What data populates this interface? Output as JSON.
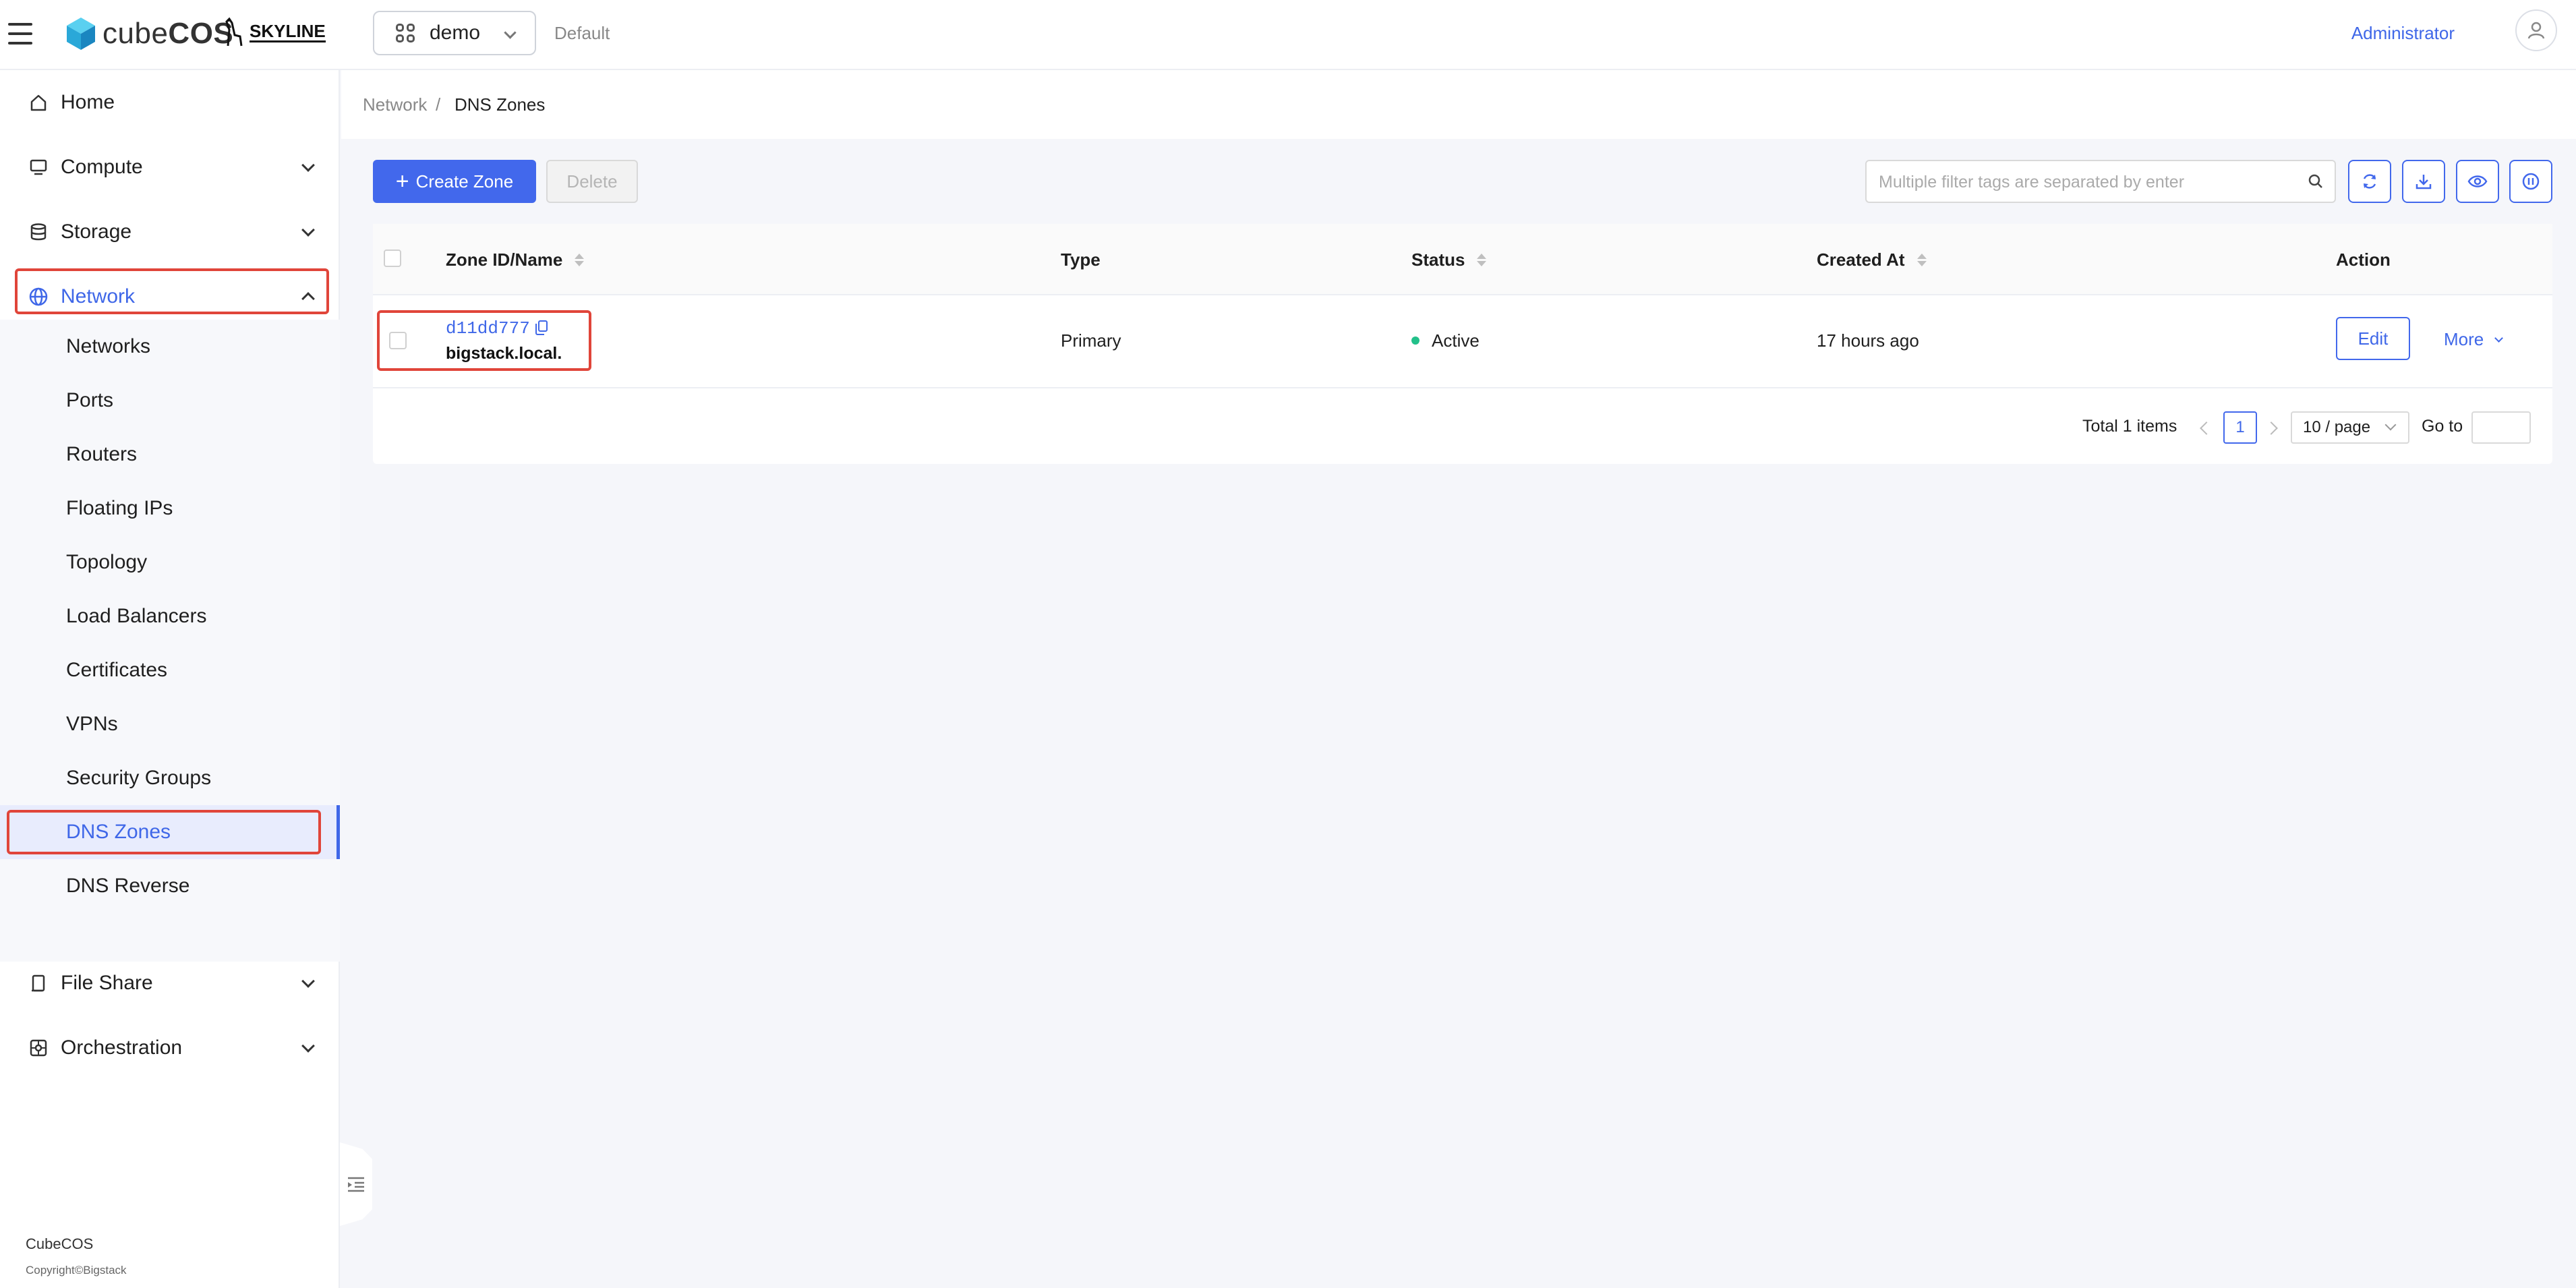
{
  "header": {
    "brand_text_light": "cube",
    "brand_text_bold": "COS",
    "partner_logo": "SKYLINE",
    "project": "demo",
    "domain": "Default",
    "user": "Administrator"
  },
  "sidebar": {
    "groups": [
      {
        "label": "Home",
        "icon": "home-icon",
        "expandable": false
      },
      {
        "label": "Compute",
        "icon": "monitor-icon",
        "expandable": true
      },
      {
        "label": "Storage",
        "icon": "database-icon",
        "expandable": true
      },
      {
        "label": "Network",
        "icon": "globe-icon",
        "expandable": true,
        "expanded": true,
        "active": true
      },
      {
        "label": "File Share",
        "icon": "file-share-icon",
        "expandable": true
      },
      {
        "label": "Orchestration",
        "icon": "orchestration-icon",
        "expandable": true
      }
    ],
    "network_items": [
      {
        "label": "Networks"
      },
      {
        "label": "Ports"
      },
      {
        "label": "Routers"
      },
      {
        "label": "Floating IPs"
      },
      {
        "label": "Topology"
      },
      {
        "label": "Load Balancers"
      },
      {
        "label": "Certificates"
      },
      {
        "label": "VPNs"
      },
      {
        "label": "Security Groups"
      },
      {
        "label": "DNS Zones",
        "selected": true
      },
      {
        "label": "DNS Reverse"
      }
    ],
    "footer_brand": "CubeCOS",
    "footer_copyright": "Copyright©Bigstack"
  },
  "breadcrumb": {
    "parent": "Network",
    "separator": "/",
    "current": "DNS Zones"
  },
  "toolbar": {
    "create_label": "Create Zone",
    "delete_label": "Delete",
    "search_placeholder": "Multiple filter tags are separated by enter",
    "tools": [
      "refresh-icon",
      "download-icon",
      "eye-icon",
      "settings-icon"
    ]
  },
  "table": {
    "columns": [
      "Zone ID/Name",
      "Type",
      "Status",
      "Created At",
      "Action"
    ],
    "rows": [
      {
        "id": "d11dd777",
        "name": "bigstack.local.",
        "type": "Primary",
        "status": "Active",
        "created_at": "17 hours ago",
        "edit_label": "Edit",
        "more_label": "More"
      }
    ]
  },
  "pagination": {
    "total": "Total 1 items",
    "current_page": "1",
    "page_size": "10 / page",
    "goto_label": "Go to"
  },
  "colors": {
    "accent": "#4268ec",
    "status_active": "#22c08a",
    "highlight_box": "#e0453a"
  }
}
